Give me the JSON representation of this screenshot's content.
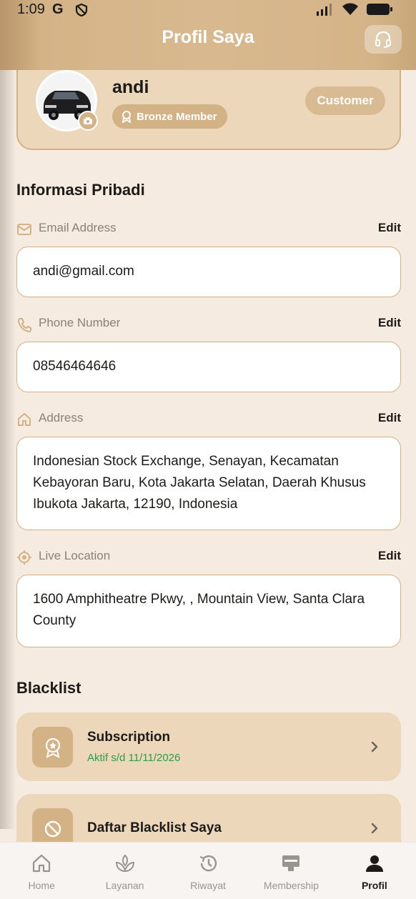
{
  "status_bar": {
    "time": "1:09",
    "google_glyph": "G"
  },
  "app_bar": {
    "title": "Profil Saya",
    "support_icon": "headset-icon"
  },
  "profile": {
    "name": "andi",
    "member_badge": "Bronze Member",
    "role": "Customer",
    "avatar_icon": "car-photo",
    "camera_icon": "camera-icon"
  },
  "personal_info": {
    "section_title": "Informasi Pribadi",
    "edit_label": "Edit",
    "fields": [
      {
        "label": "Email Address",
        "icon": "mail-icon",
        "value": "andi@gmail.com"
      },
      {
        "label": "Phone Number",
        "icon": "phone-icon",
        "value": "08546464646"
      },
      {
        "label": "Address",
        "icon": "home-icon",
        "value": "Indonesian Stock Exchange, Senayan, Kecamatan Kebayoran Baru, Kota Jakarta Selatan, Daerah Khusus Ibukota Jakarta, 12190, Indonesia"
      },
      {
        "label": "Live Location",
        "icon": "location-target-icon",
        "value": "1600 Amphitheatre Pkwy, , Mountain View, Santa Clara County"
      }
    ]
  },
  "blacklist": {
    "section_title": "Blacklist",
    "items": [
      {
        "title": "Subscription",
        "subtitle": "Aktif s/d 11/11/2026",
        "icon": "award-icon"
      },
      {
        "title": "Daftar Blacklist Saya",
        "icon": "blocked-icon"
      }
    ]
  },
  "bottom_nav": {
    "items": [
      {
        "label": "Home",
        "icon": "home-icon"
      },
      {
        "label": "Layanan",
        "icon": "leaf-icon"
      },
      {
        "label": "Riwayat",
        "icon": "history-icon"
      },
      {
        "label": "Membership",
        "icon": "card-icon"
      },
      {
        "label": "Profil",
        "icon": "person-icon",
        "active": true
      }
    ]
  },
  "colors": {
    "accent": "#d3b285",
    "background": "#f6ebe0",
    "card": "#ecd7bb",
    "success_text": "#2e9b48"
  }
}
